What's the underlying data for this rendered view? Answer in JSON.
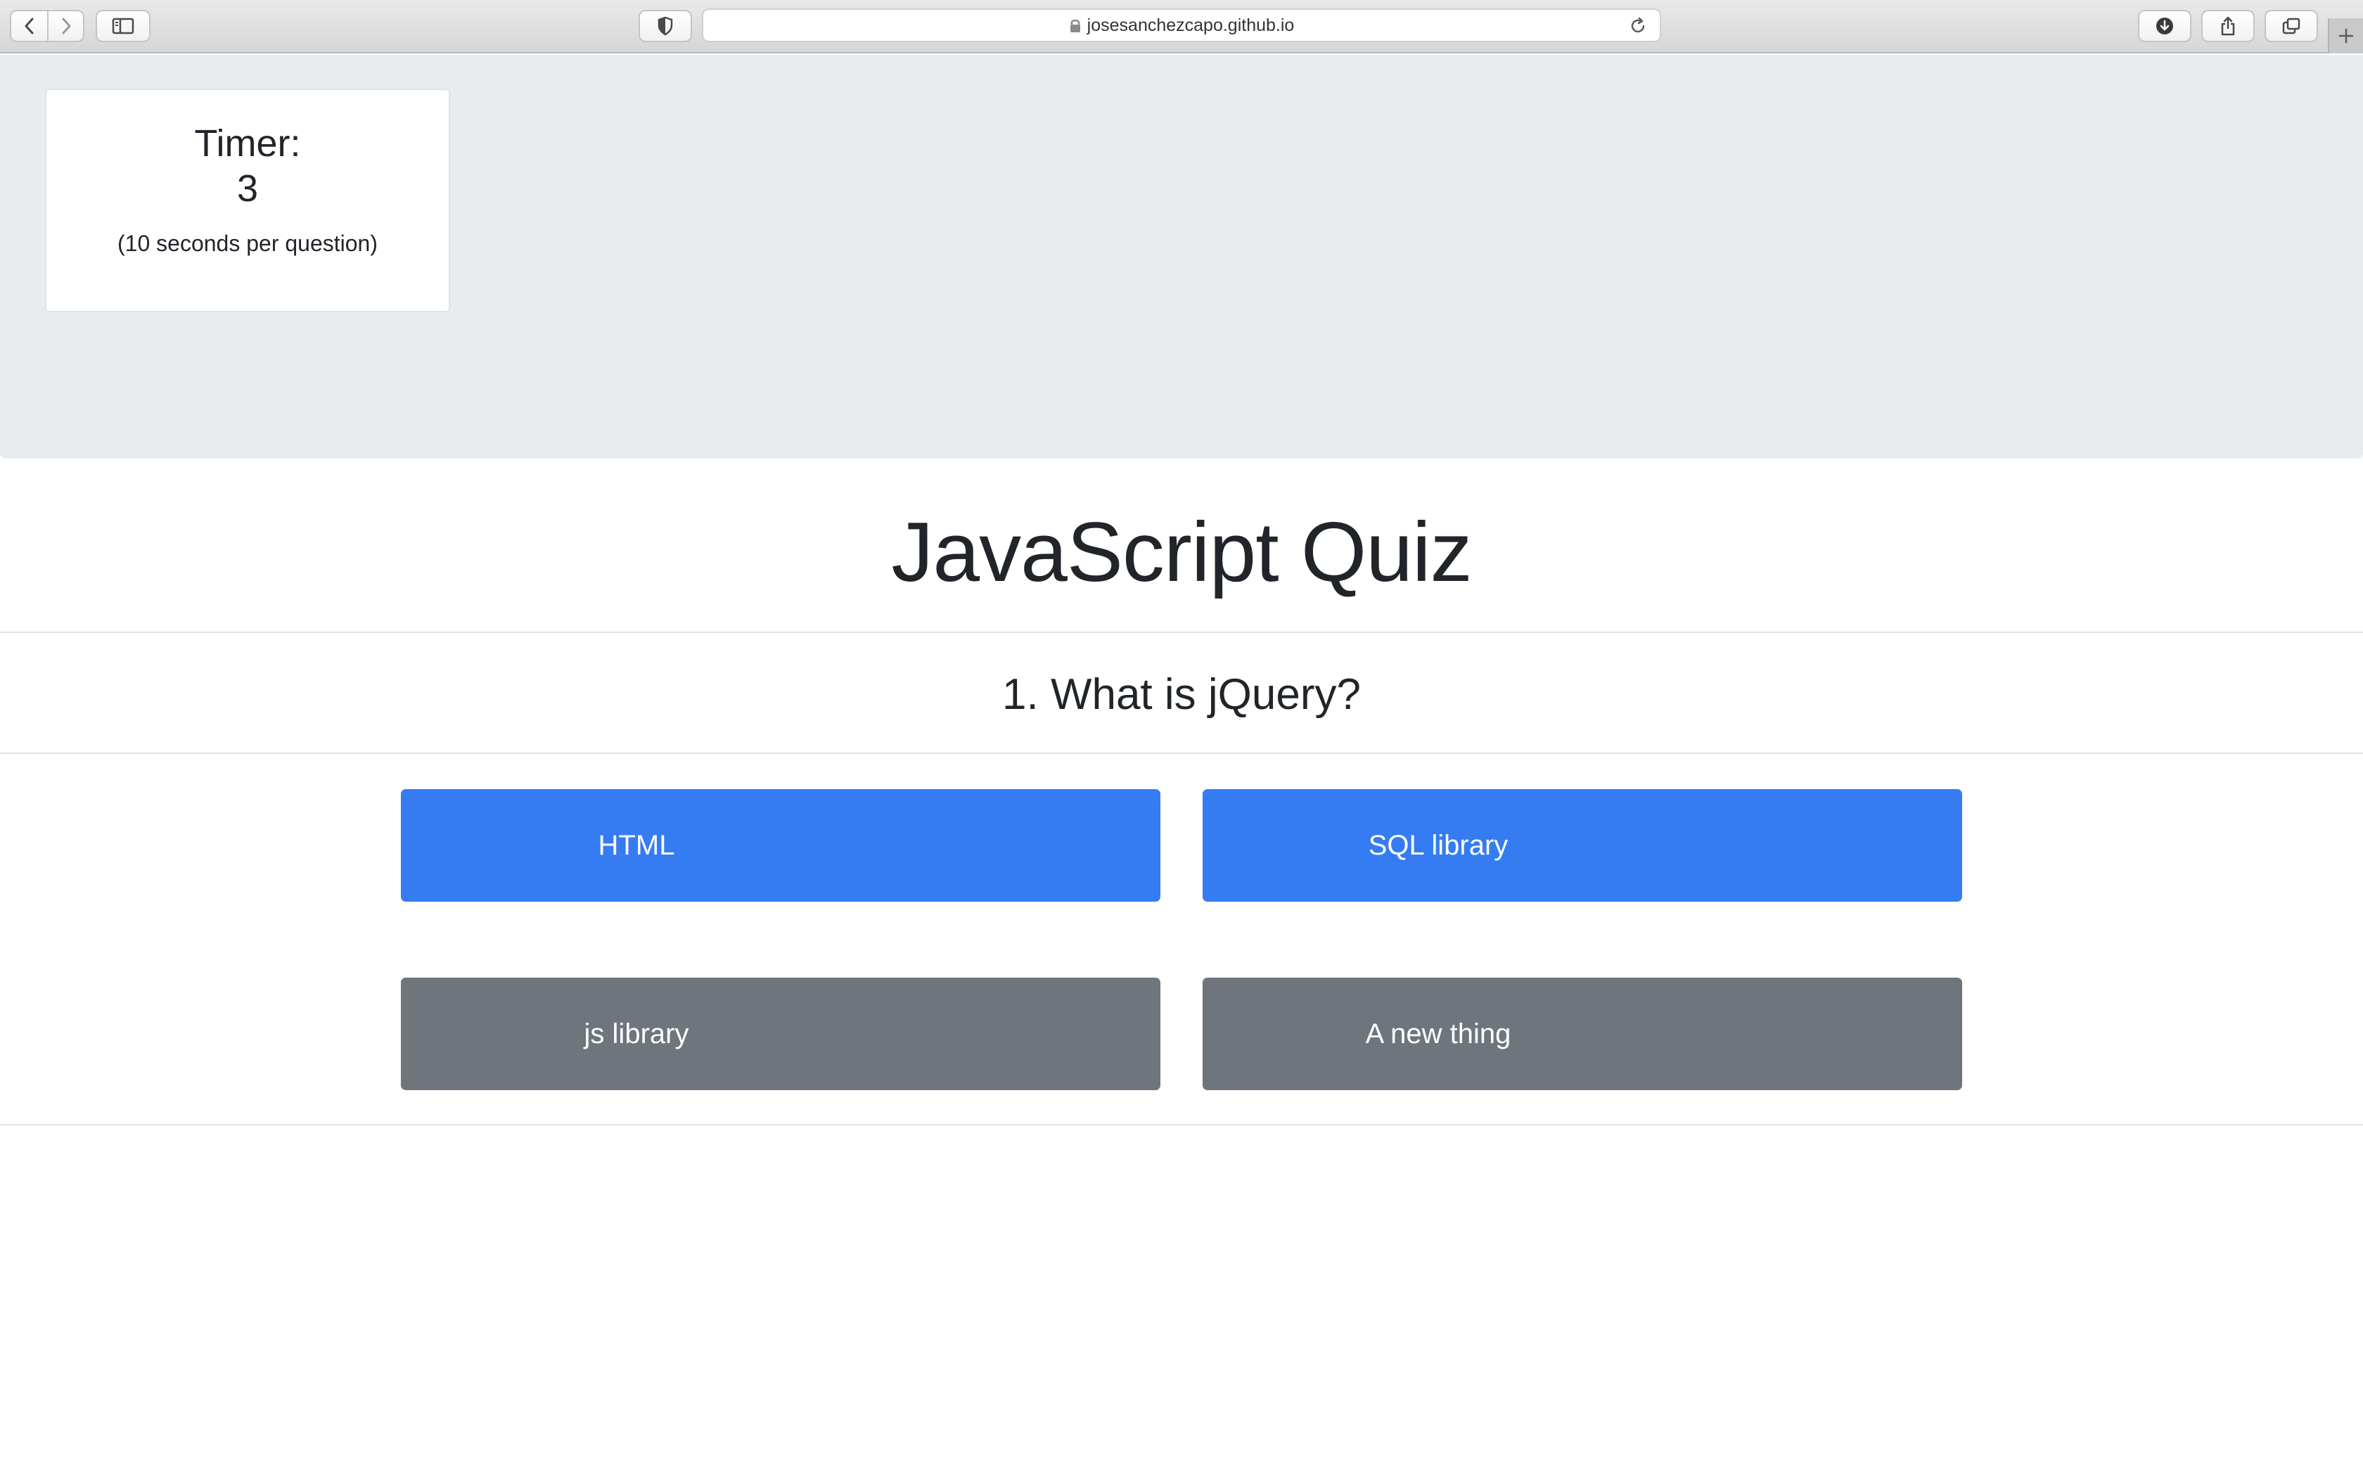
{
  "browser": {
    "url": "josesanchezcapo.github.io",
    "icons": {
      "back": "chevron-left-icon",
      "forward": "chevron-right-icon",
      "sidebar": "sidebar-icon",
      "privacy": "shield-icon",
      "lock": "lock-icon",
      "reload": "reload-icon",
      "download": "download-icon",
      "share": "share-icon",
      "tabs": "tabs-overview-icon",
      "new_tab": "plus-icon"
    }
  },
  "timer": {
    "title": "Timer:",
    "value": "3",
    "note": "(10 seconds per question)"
  },
  "quiz": {
    "title": "JavaScript Quiz",
    "question": "1. What is jQuery?",
    "answers": [
      {
        "label": "HTML",
        "style": "primary"
      },
      {
        "label": "SQL library",
        "style": "primary"
      },
      {
        "label": "js library",
        "style": "secondary"
      },
      {
        "label": "A new thing",
        "style": "secondary"
      }
    ]
  },
  "colors": {
    "primary": "#357cf2",
    "secondary": "#6e757d",
    "jumbotron": "#e9ecef"
  }
}
